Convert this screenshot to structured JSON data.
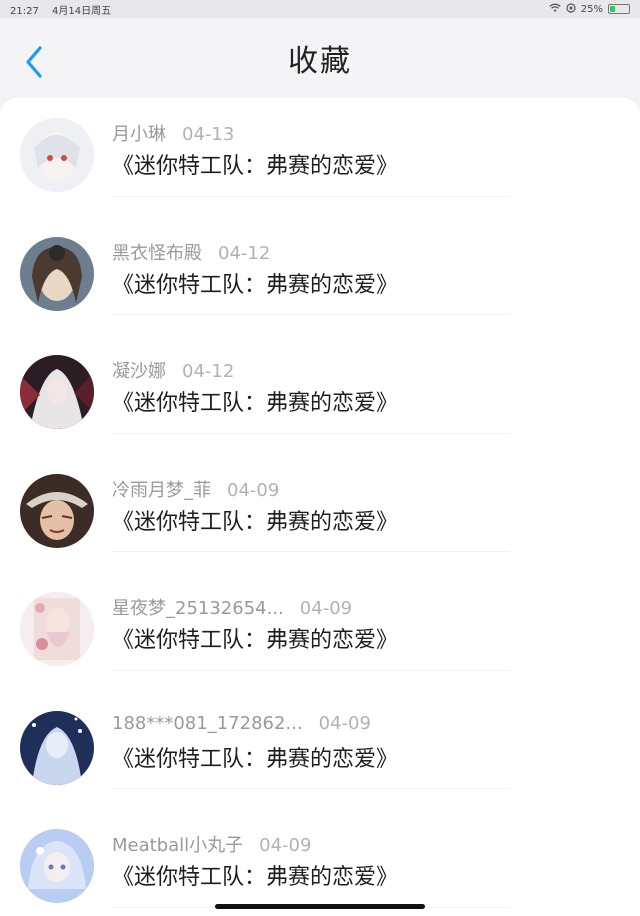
{
  "status": {
    "time": "21:27",
    "date": "4月14日周五",
    "battery": "25%",
    "battery_level": 0.25
  },
  "header": {
    "title": "收藏"
  },
  "items": [
    {
      "user": "月小琳",
      "date": "04-13",
      "text": "《迷你特工队：弗赛的恋爱》"
    },
    {
      "user": "黑衣怪布殿",
      "date": "04-12",
      "text": "《迷你特工队：弗赛的恋爱》"
    },
    {
      "user": "凝沙娜",
      "date": "04-12",
      "text": "《迷你特工队：弗赛的恋爱》"
    },
    {
      "user": "冷雨月梦_菲",
      "date": "04-09",
      "text": "《迷你特工队：弗赛的恋爱》"
    },
    {
      "user": "星夜梦_25132654...",
      "date": "04-09",
      "text": "《迷你特工队：弗赛的恋爱》"
    },
    {
      "user": "188***081_172862...",
      "date": "04-09",
      "text": "《迷你特工队：弗赛的恋爱》"
    },
    {
      "user": "Meatball小丸子",
      "date": "04-09",
      "text": "《迷你特工队：弗赛的恋爱》"
    }
  ],
  "colors": {
    "accent": "#1e9bf0",
    "battery": "#34c759"
  }
}
